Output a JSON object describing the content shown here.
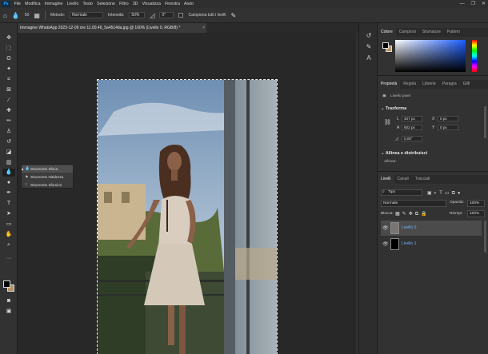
{
  "menu": {
    "app_logo": "Ps",
    "items": [
      "File",
      "Modifica",
      "Immagine",
      "Livello",
      "Testo",
      "Selezione",
      "Filtro",
      "3D",
      "Visualizza",
      "Finestra",
      "Aiuto"
    ],
    "window_controls": [
      "—",
      "❐",
      "✕"
    ]
  },
  "options": {
    "brush_size": "50",
    "mode_label": "Metodo:",
    "mode_value": "Normale",
    "strength_label": "Intensità:",
    "strength_value": "50%",
    "angle_value": "0°",
    "sample_all_label": "Campiona tutti i livelli"
  },
  "document": {
    "tab_title": "Immagine WhatsApp 2023-12-09 ore 11.00.46_5a4514da.jpg @ 100% (Livello 0, RGB/8) *",
    "close_icon": "×"
  },
  "flyout": {
    "items": [
      "Strumento Sfoca",
      "Strumento Nitidezza",
      "Strumento Sfumino"
    ],
    "selected_index": 0
  },
  "color_panel": {
    "tabs": [
      "Colore",
      "Campioni",
      "Sfumature",
      "Pattern"
    ],
    "active_tab": "Colore",
    "foreground": "#000000",
    "background": "#b49461"
  },
  "properties_panel": {
    "tabs": [
      "Proprietà",
      "Regola",
      "Librerie",
      "Paragra",
      "Glifi"
    ],
    "active_tab": "Proprietà",
    "layer_type": "Livello pixel",
    "transform_title": "Trasforma",
    "w_label": "L",
    "w_value": "407 px",
    "h_label": "A",
    "h_value": "602 px",
    "x_label": "X",
    "x_value": "0 px",
    "y_label": "Y",
    "y_value": "0 px",
    "angle_value": "0,00°",
    "align_title": "Allinea e distribuisci",
    "align_label": "Allinea:"
  },
  "layers_panel": {
    "tabs": [
      "Livelli",
      "Canali",
      "Tracciati"
    ],
    "active_tab": "Livelli",
    "filter_value": "Tipo",
    "blend_mode": "Normale",
    "opacity_label": "Opacità:",
    "opacity_value": "100%",
    "lock_label": "Blocca:",
    "fill_label": "Riempi:",
    "fill_value": "100%",
    "layers": [
      {
        "name": "Livello 0",
        "selected": true
      },
      {
        "name": "Livello 1",
        "selected": false
      }
    ]
  },
  "accent_color": "#31a8ff"
}
